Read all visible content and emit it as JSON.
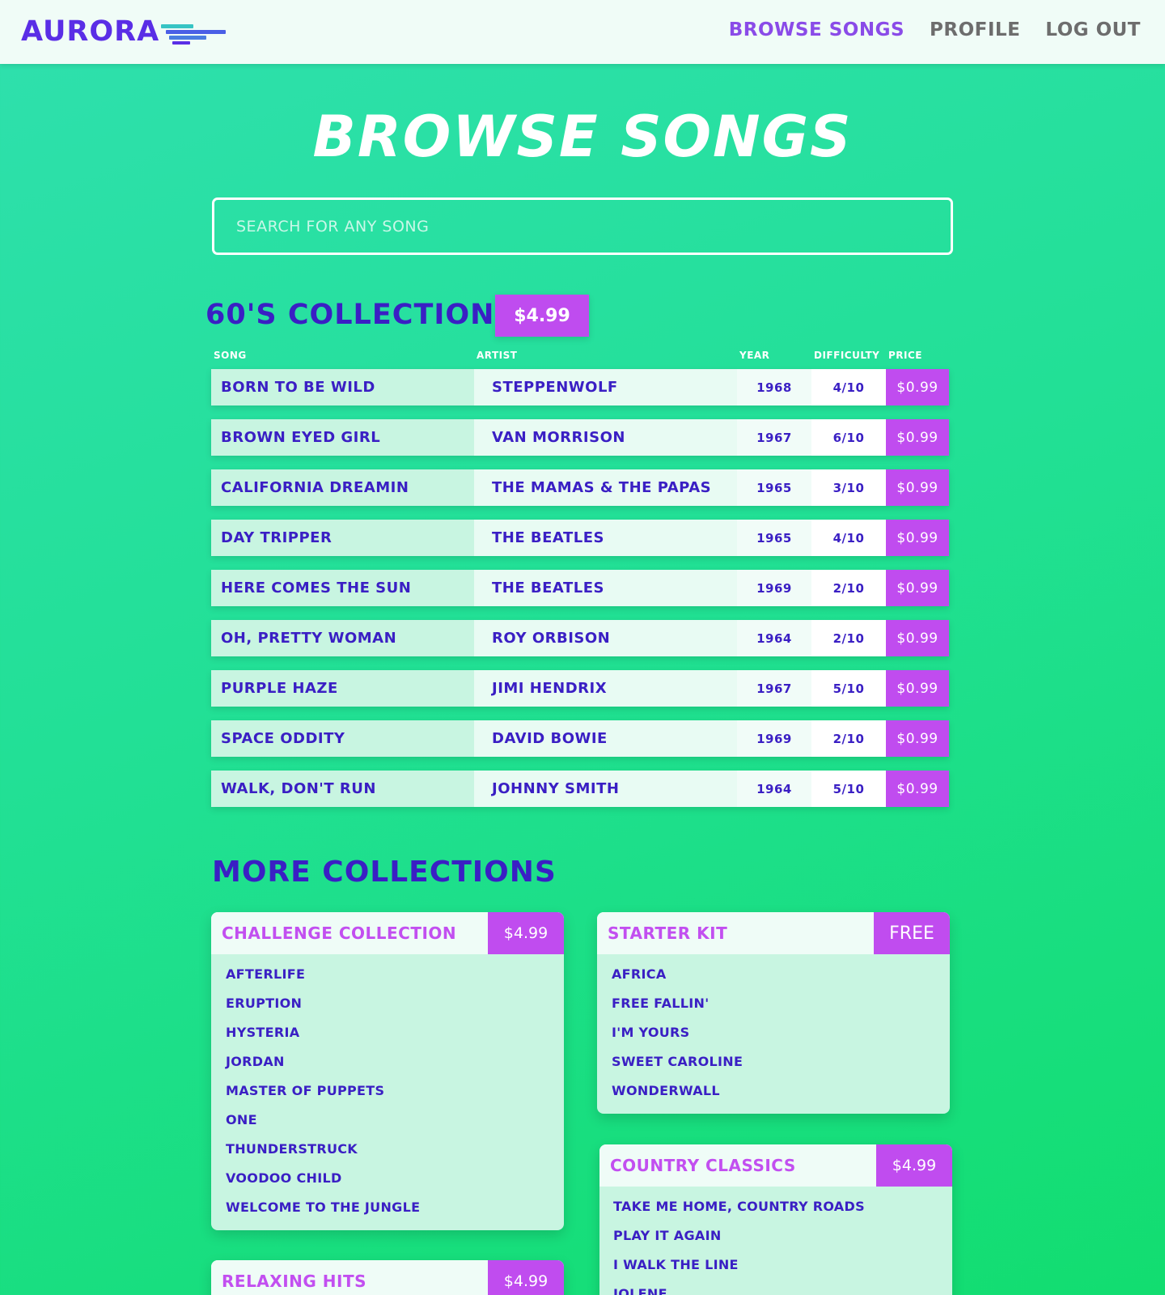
{
  "nav": {
    "logo_text": "AURORA",
    "links": [
      "BROWSE SONGS",
      "PROFILE",
      "LOG OUT"
    ],
    "active_link": "BROWSE SONGS"
  },
  "page_title": "BROWSE SONGS",
  "search": {
    "placeholder": "SEARCH FOR ANY SONG",
    "value": ""
  },
  "featured_collection": {
    "title": "60'S COLLECTION",
    "price": "$4.99",
    "columns": [
      "SONG",
      "ARTIST",
      "YEAR",
      "DIFFICULTY",
      "PRICE"
    ],
    "songs": [
      {
        "song": "BORN TO BE WILD",
        "artist": "STEPPENWOLF",
        "year": "1968",
        "difficulty": "4/10",
        "price": "$0.99"
      },
      {
        "song": "BROWN EYED GIRL",
        "artist": "VAN MORRISON",
        "year": "1967",
        "difficulty": "6/10",
        "price": "$0.99"
      },
      {
        "song": "CALIFORNIA DREAMIN",
        "artist": "THE MAMAS & THE PAPAS",
        "year": "1965",
        "difficulty": "3/10",
        "price": "$0.99"
      },
      {
        "song": "DAY TRIPPER",
        "artist": "THE BEATLES",
        "year": "1965",
        "difficulty": "4/10",
        "price": "$0.99"
      },
      {
        "song": "HERE COMES THE SUN",
        "artist": "THE BEATLES",
        "year": "1969",
        "difficulty": "2/10",
        "price": "$0.99"
      },
      {
        "song": "OH, PRETTY WOMAN",
        "artist": "ROY ORBISON",
        "year": "1964",
        "difficulty": "2/10",
        "price": "$0.99"
      },
      {
        "song": "PURPLE HAZE",
        "artist": "JIMI HENDRIX",
        "year": "1967",
        "difficulty": "5/10",
        "price": "$0.99"
      },
      {
        "song": "SPACE ODDITY",
        "artist": "DAVID BOWIE",
        "year": "1969",
        "difficulty": "2/10",
        "price": "$0.99"
      },
      {
        "song": "WALK, DON'T RUN",
        "artist": "JOHNNY SMITH",
        "year": "1964",
        "difficulty": "5/10",
        "price": "$0.99"
      }
    ]
  },
  "more_collections": {
    "heading": "MORE COLLECTIONS",
    "cards": [
      {
        "title": "CHALLENGE COLLECTION",
        "price": "$4.99",
        "songs": [
          "AFTERLIFE",
          "ERUPTION",
          "HYSTERIA",
          "JORDAN",
          "MASTER OF PUPPETS",
          "ONE",
          "THUNDERSTRUCK",
          "VOODOO CHILD",
          "WELCOME TO THE JUNGLE"
        ]
      },
      {
        "title": "STARTER KIT",
        "price": "FREE",
        "songs": [
          "AFRICA",
          "FREE FALLIN'",
          "I'M YOURS",
          "SWEET CAROLINE",
          "WONDERWALL"
        ]
      },
      {
        "title": "COUNTRY CLASSICS",
        "price": "$4.99",
        "songs": [
          "TAKE ME HOME, COUNTRY ROADS",
          "PLAY IT AGAIN",
          "I WALK THE LINE",
          "JOLENE"
        ]
      },
      {
        "title": "RELAXING HITS",
        "price": "$4.99",
        "songs": []
      }
    ]
  },
  "colors": {
    "brand": "#5a2ee6",
    "accent_purple": "#c04cef",
    "text_indigo": "#3a1fc4",
    "background_green": "#22e096"
  }
}
